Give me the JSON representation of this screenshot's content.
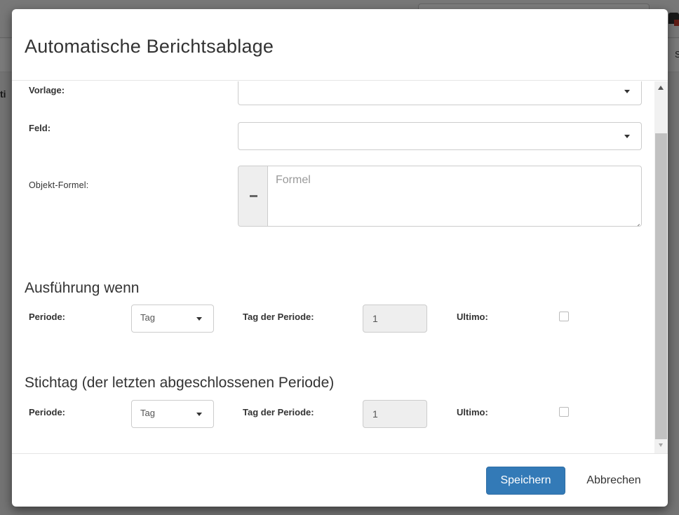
{
  "dialog": {
    "title": "Automatische Berichtsablage"
  },
  "form": {
    "vorlage_label": "Vorlage:",
    "vorlage_value": "",
    "feld_label": "Feld:",
    "feld_value": "",
    "formel_label": "Objekt-Formel:",
    "formel_placeholder": "Formel",
    "formel_value": ""
  },
  "execution": {
    "heading": "Ausführung wenn",
    "periode_label": "Periode:",
    "periode_value": "Tag",
    "tag_label": "Tag der Periode:",
    "tag_value": "1",
    "ultimo_label": "Ultimo:",
    "ultimo_checked": false
  },
  "cutoff": {
    "heading": "Stichtag (der letzten abgeschlossenen Periode)",
    "periode_label": "Periode:",
    "periode_value": "Tag",
    "tag_label": "Tag der Periode:",
    "tag_value": "1",
    "ultimo_label": "Ultimo:",
    "ultimo_checked": false
  },
  "footer": {
    "save_label": "Speichern",
    "cancel_label": "Abbrechen"
  },
  "background": {
    "left_fragment": "ti",
    "right_fragment": "S"
  },
  "colors": {
    "primary": "#337ab7",
    "overlay": "#000000"
  }
}
